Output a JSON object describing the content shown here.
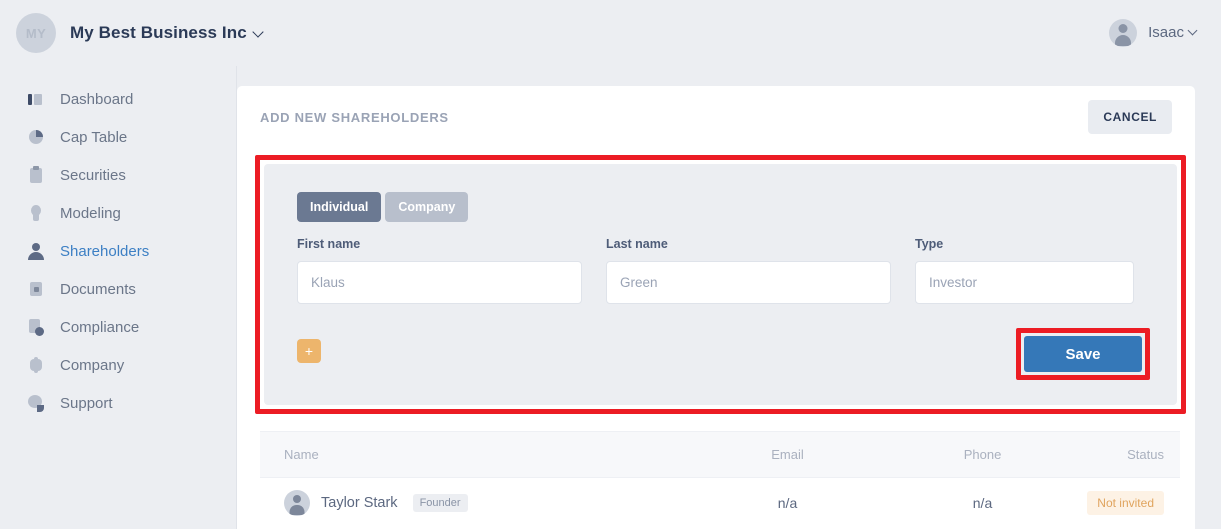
{
  "topbar": {
    "brand_initials": "MY",
    "brand_name": "My Best Business Inc",
    "user_name": "Isaac"
  },
  "sidebar": {
    "items": [
      {
        "label": "Dashboard",
        "icon": "dashboard-icon",
        "active": false
      },
      {
        "label": "Cap Table",
        "icon": "pie-chart-icon",
        "active": false
      },
      {
        "label": "Securities",
        "icon": "clipboard-icon",
        "active": false
      },
      {
        "label": "Modeling",
        "icon": "lightbulb-icon",
        "active": false
      },
      {
        "label": "Shareholders",
        "icon": "person-icon",
        "active": true
      },
      {
        "label": "Documents",
        "icon": "document-icon",
        "active": false
      },
      {
        "label": "Compliance",
        "icon": "document-check-icon",
        "active": false
      },
      {
        "label": "Company",
        "icon": "company-icon",
        "active": false
      },
      {
        "label": "Support",
        "icon": "help-bubble-icon",
        "active": false
      }
    ]
  },
  "panel": {
    "title": "ADD NEW SHAREHOLDERS",
    "cancel_label": "CANCEL"
  },
  "form": {
    "segments": [
      {
        "label": "Individual",
        "selected": true
      },
      {
        "label": "Company",
        "selected": false
      }
    ],
    "fields": [
      {
        "label": "First name",
        "value": "Klaus"
      },
      {
        "label": "Last name",
        "value": "Green"
      },
      {
        "label": "Type",
        "value": "Investor"
      }
    ],
    "add_label": "+",
    "save_label": "Save"
  },
  "table": {
    "columns": [
      "Name",
      "Email",
      "Phone",
      "Status"
    ],
    "rows": [
      {
        "name": "Taylor Stark",
        "role_badge": "Founder",
        "email": "n/a",
        "phone": "n/a",
        "status": "Not invited"
      }
    ]
  },
  "colors": {
    "accent_blue": "#3578b8",
    "active_nav": "#3c7fc4",
    "highlight_red": "#ec1c24",
    "add_button_orange": "#edb56c",
    "status_badge_bg": "#fdf2e5",
    "status_badge_text": "#e0a45e",
    "page_bg": "#eceef2"
  }
}
